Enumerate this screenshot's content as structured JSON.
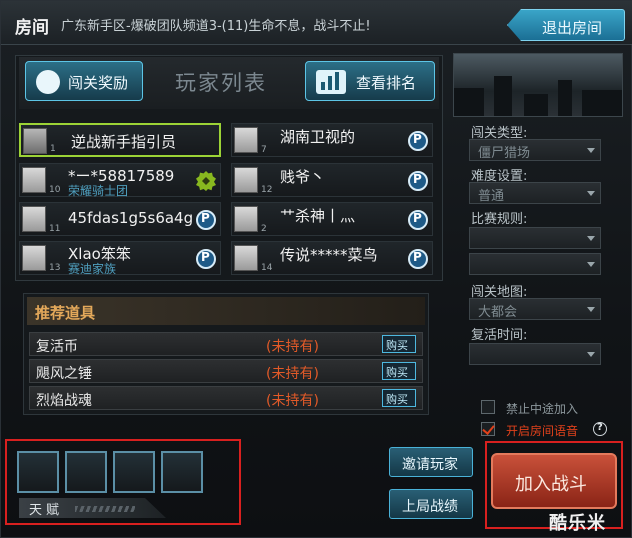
{
  "window": {
    "title": "房间",
    "channel": "广东新手区-爆破团队频道3-(11)生命不息，战斗不止!",
    "exit_label": "退出房间"
  },
  "player_list": {
    "title": "玩家列表",
    "reward_tab": "闯关奖励",
    "rank_tab": "查看排名",
    "players": [
      {
        "num": "1",
        "name": "逆战新手指引员",
        "clan": "",
        "badge": "",
        "active": true
      },
      {
        "num": "7",
        "name": "湖南卫视的",
        "clan": "",
        "badge": "P"
      },
      {
        "num": "10",
        "name": "*ー*58817589",
        "clan": "荣耀骑士团",
        "badge": "gear"
      },
      {
        "num": "12",
        "name": "贱爷丶",
        "clan": "",
        "badge": "P"
      },
      {
        "num": "11",
        "name": "45fdas1g5s6a4g",
        "clan": "",
        "badge": "P"
      },
      {
        "num": "2",
        "name": "艹杀神丨灬",
        "clan": "",
        "badge": "P"
      },
      {
        "num": "13",
        "name": "Xlao笨笨",
        "clan": "赛迪家族",
        "badge": "P"
      },
      {
        "num": "14",
        "name": "传说*****菜鸟",
        "clan": "",
        "badge": "P"
      }
    ]
  },
  "recommended": {
    "title": "推荐道具",
    "items": [
      {
        "name": "复活币",
        "status": "(未持有)",
        "buy": "购买"
      },
      {
        "name": "飓风之锤",
        "status": "(未持有)",
        "buy": "购买"
      },
      {
        "name": "烈焰战魂",
        "status": "(未持有)",
        "buy": "购买"
      }
    ]
  },
  "settings": {
    "stage_type_label": "闯关类型:",
    "stage_type_value": "僵尸猎场",
    "difficulty_label": "难度设置:",
    "difficulty_value": "普通",
    "rules_label": "比赛规则:",
    "rules_value_1": "",
    "rules_value_2": "",
    "map_label": "闯关地图:",
    "map_value": "大都会",
    "respawn_label": "复活时间:",
    "respawn_value": "",
    "no_join_label": "禁止中途加入",
    "no_join_checked": false,
    "voice_label": "开启房间语音",
    "voice_checked": true,
    "help": "?"
  },
  "bottom": {
    "talent_label": "天赋",
    "invite_label": "邀请玩家",
    "last_score_label": "上局战绩",
    "join_label": "加入战斗",
    "watermark": "酷乐米"
  },
  "colors": {
    "accent_blue": "#3aa5c8",
    "active_green": "#9cd336",
    "status_orange": "#e25a28",
    "join_red": "#c9513a",
    "highlight_red": "#d8201f"
  }
}
